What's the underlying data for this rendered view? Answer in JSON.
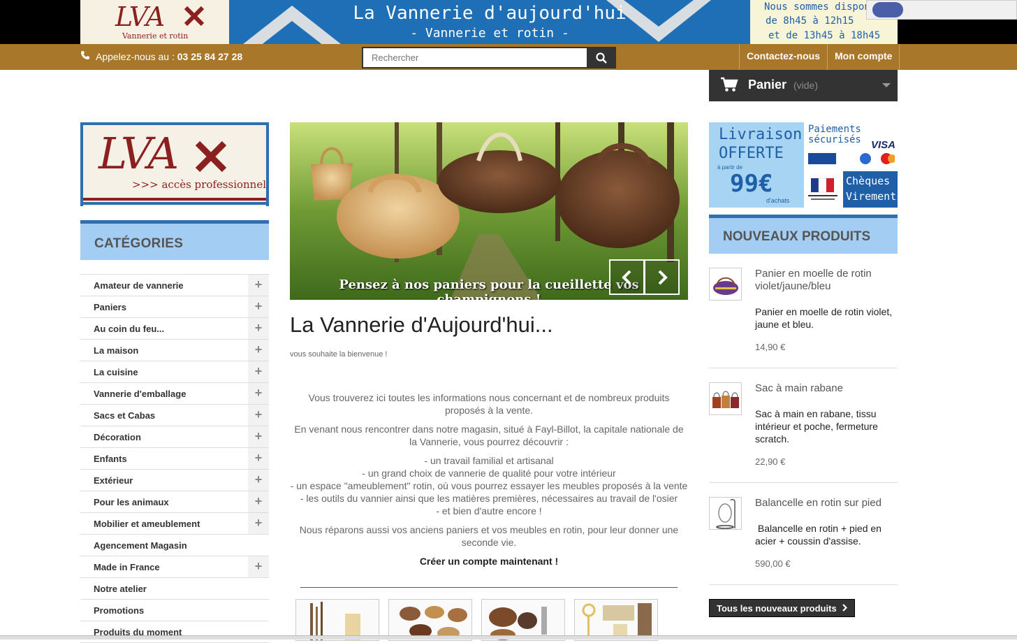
{
  "header": {
    "logo_text": "LVA",
    "logo_subtitle": "Vannerie et rotin",
    "banner_title": "La Vannerie d'aujourd'hui",
    "banner_subtitle": "- Vannerie et rotin -",
    "hours_line1": "Nous sommes disponi",
    "hours_line2": "de 8h45 à 12h15",
    "hours_line3": "et de 13h45 à 18h45"
  },
  "navbar": {
    "phone_label": "Appelez-nous au :",
    "phone_number": "03 25 84 27 28",
    "search_placeholder": "Rechercher",
    "links": [
      "Contactez-nous",
      "Mon compte"
    ]
  },
  "cart": {
    "label": "Panier",
    "status": "(vide)"
  },
  "pro_logo": {
    "text": "LVA",
    "subtitle": ">>> accès professionnel"
  },
  "categories": {
    "title": "Catégories",
    "items": [
      {
        "label": "Amateur de vannerie",
        "expandable": true
      },
      {
        "label": "Paniers",
        "expandable": true
      },
      {
        "label": "Au coin du feu...",
        "expandable": true
      },
      {
        "label": "La maison",
        "expandable": true
      },
      {
        "label": "La cuisine",
        "expandable": true
      },
      {
        "label": "Vannerie d'emballage",
        "expandable": true
      },
      {
        "label": "Sacs et Cabas",
        "expandable": true
      },
      {
        "label": "Décoration",
        "expandable": true
      },
      {
        "label": "Enfants",
        "expandable": true
      },
      {
        "label": "Extérieur",
        "expandable": true
      },
      {
        "label": "Pour les animaux",
        "expandable": true
      },
      {
        "label": "Mobilier et ameublement",
        "expandable": true
      },
      {
        "label": "Agencement Magasin",
        "expandable": false
      },
      {
        "label": "Made in France",
        "expandable": true
      },
      {
        "label": "Notre atelier",
        "expandable": false
      },
      {
        "label": "Promotions",
        "expandable": false
      },
      {
        "label": "Produits du moment",
        "expandable": false
      }
    ]
  },
  "slider": {
    "caption": "Pensez à nos paniers pour la cueillette vos champignons !"
  },
  "welcome": {
    "title": "La Vannerie d'Aujourd'hui...",
    "subtitle": "vous souhaite la bienvenue !",
    "para1": "Vous trouverez ici toutes les informations nous concernant et de nombreux produits proposés à la vente.",
    "para2": "En venant nous rencontrer dans notre magasin, situé à Fayl-Billot, la capitale nationale de la Vannerie, vous pourrez découvrir :",
    "bullets": [
      "- un travail familial et artisanal",
      "- un grand choix de vannerie de qualité pour votre intérieur",
      "- un espace \"ameublement\" rotin, où vous pourrez essayer les meubles proposés à la vente",
      "- les outils du vannier ainsi que les matières premières, nécessaires au travail de l'osier",
      "- et bien d'autre encore !"
    ],
    "para3": "Nous réparons aussi vos anciens paniers et vos meubles en rotin, pour leur donner une seconde vie.",
    "cta": "Créer un compte maintenant !"
  },
  "delivery": {
    "line1": "Livraison",
    "line2": "OFFERTE",
    "line3": "à partir de",
    "amount": "99€",
    "line5": "d'achats",
    "payments": "Paiements sécurisés",
    "visa": "VISA",
    "cheques": "Chèques",
    "virements": "Virements"
  },
  "new_products": {
    "title": "Nouveaux produits",
    "items": [
      {
        "name": "Panier en moelle de rotin violet/jaune/bleu",
        "desc": "Panier en moelle de rotin violet, jaune et bleu.",
        "price": "14,90 €"
      },
      {
        "name": "Sac à main rabane",
        "desc": "Sac à main en rabane, tissu intérieur et poche, fermeture scratch.",
        "price": "22,90 €"
      },
      {
        "name": "Balancelle en rotin sur pied",
        "desc": " Balancelle en rotin + pied en acier + coussin d'assise.",
        "price": "590,00 €"
      }
    ],
    "all_button": "Tous les nouveaux produits"
  },
  "colors": {
    "navbar": "#a8772a",
    "accent_blue": "#2e6fb0",
    "light_blue": "#a3cdf2",
    "dark": "#333333",
    "brand_red": "#8c2020"
  }
}
